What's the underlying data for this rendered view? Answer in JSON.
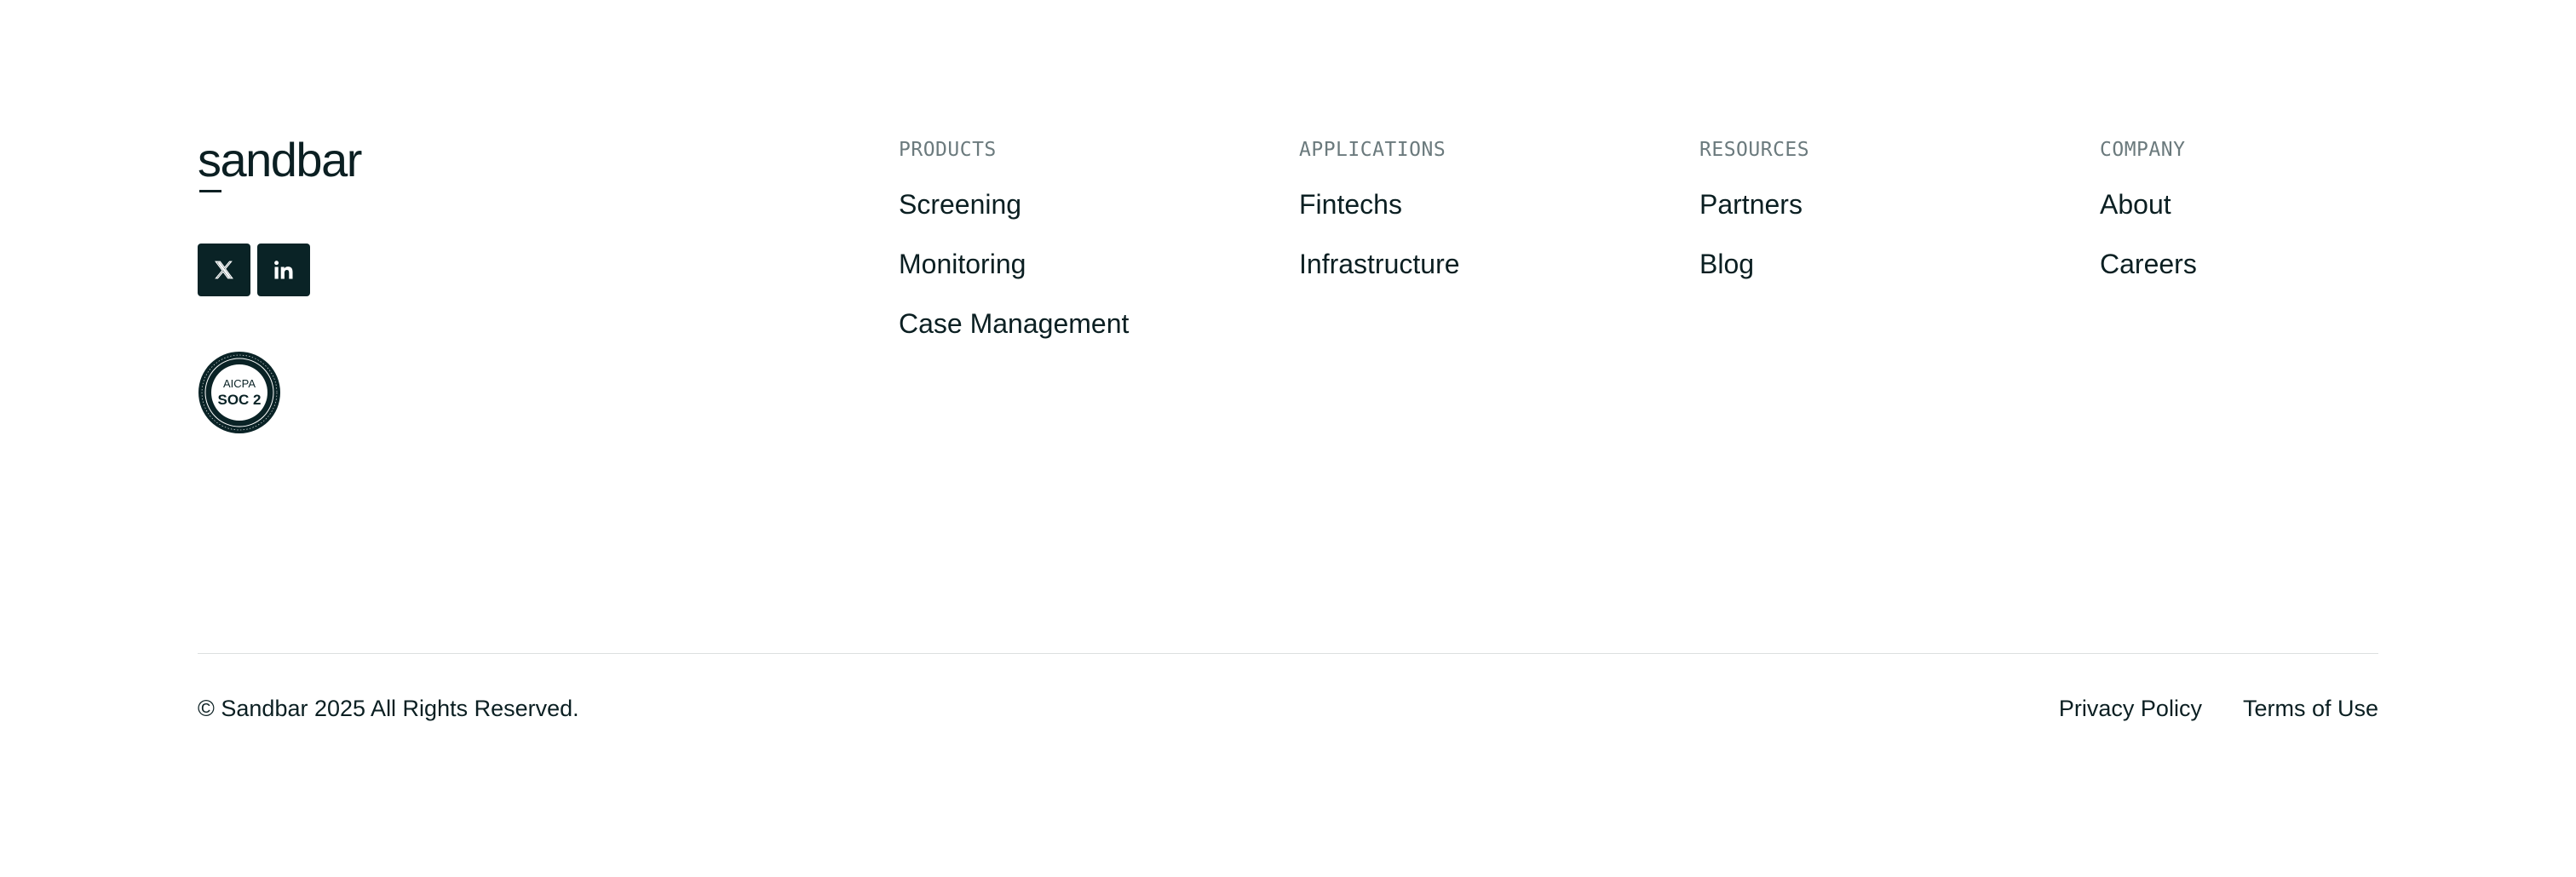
{
  "brand": {
    "logo_text": "sandbar"
  },
  "socials": [
    {
      "name": "x-icon",
      "label": "X"
    },
    {
      "name": "linkedin-icon",
      "label": "in"
    }
  ],
  "badge": {
    "top_text": "AICPA",
    "main_text": "SOC 2"
  },
  "columns": [
    {
      "title": "PRODUCTS",
      "links": [
        "Screening",
        "Monitoring",
        "Case Management"
      ]
    },
    {
      "title": "APPLICATIONS",
      "links": [
        "Fintechs",
        "Infrastructure"
      ]
    },
    {
      "title": "RESOURCES",
      "links": [
        "Partners",
        "Blog"
      ]
    },
    {
      "title": "COMPANY",
      "links": [
        "About",
        "Careers"
      ]
    }
  ],
  "bottom": {
    "copyright": "© Sandbar 2025 All Rights Reserved.",
    "privacy_label": "Privacy Policy",
    "terms_label": "Terms of Use"
  },
  "colors": {
    "ink": "#0b1f22",
    "button_bg": "#0a2326",
    "muted": "#6b7a7d",
    "divider": "#dcdfe0"
  }
}
